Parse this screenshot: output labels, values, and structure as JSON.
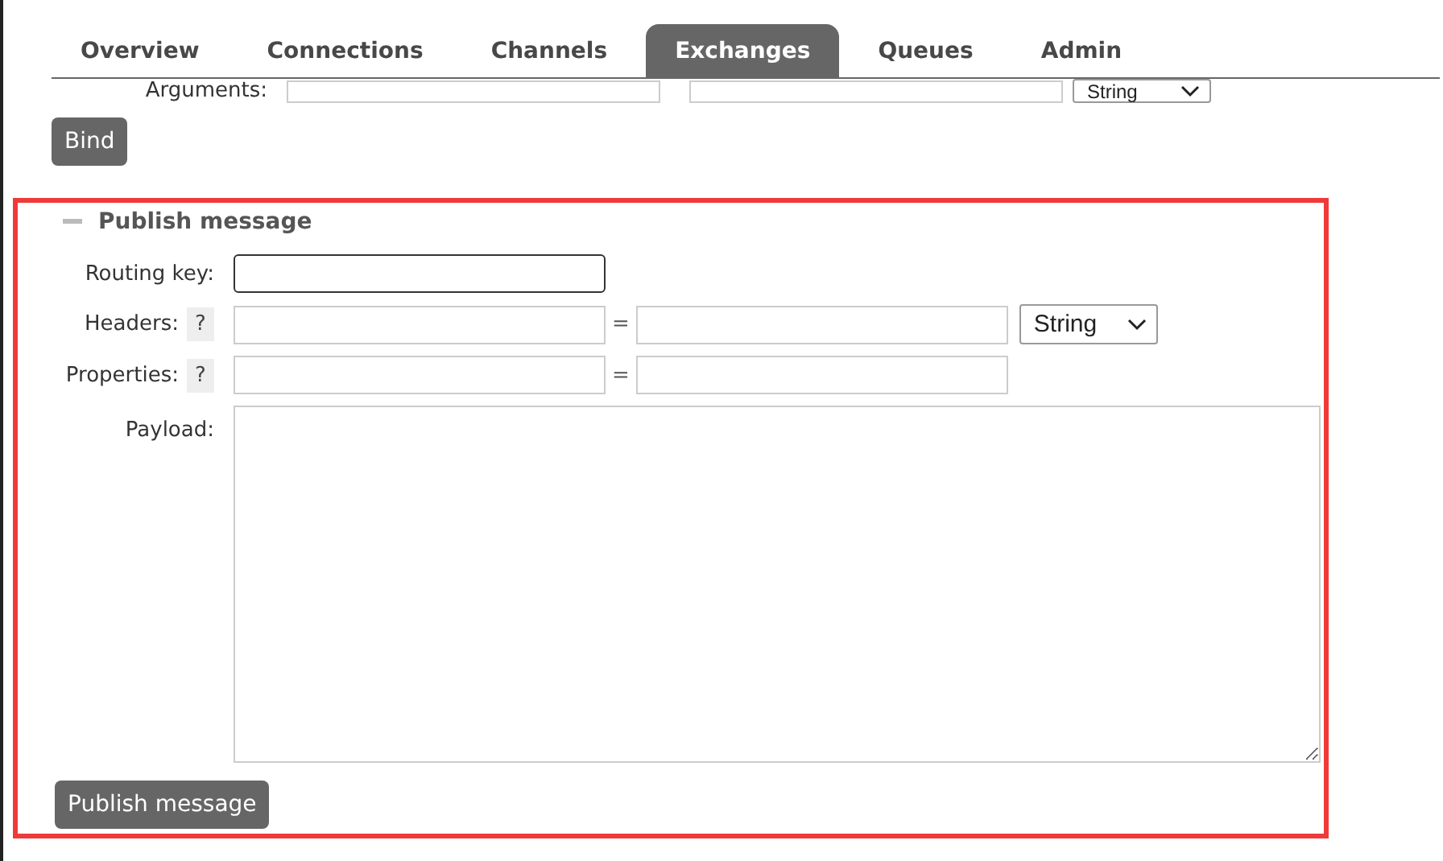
{
  "tabs": [
    {
      "label": "Overview",
      "selected": false
    },
    {
      "label": "Connections",
      "selected": false
    },
    {
      "label": "Channels",
      "selected": false
    },
    {
      "label": "Exchanges",
      "selected": true
    },
    {
      "label": "Queues",
      "selected": false
    },
    {
      "label": "Admin",
      "selected": false
    }
  ],
  "binding": {
    "arguments_label": "Arguments:",
    "arguments_type": "String",
    "bind_button": "Bind"
  },
  "publish": {
    "expanded": true,
    "title": "Publish message",
    "routing_key_label": "Routing key:",
    "headers_label": "Headers:",
    "headers_help": "?",
    "headers_equals": "=",
    "headers_type": "String",
    "properties_label": "Properties:",
    "properties_help": "?",
    "properties_equals": "=",
    "payload_label": "Payload:",
    "submit": "Publish message"
  }
}
